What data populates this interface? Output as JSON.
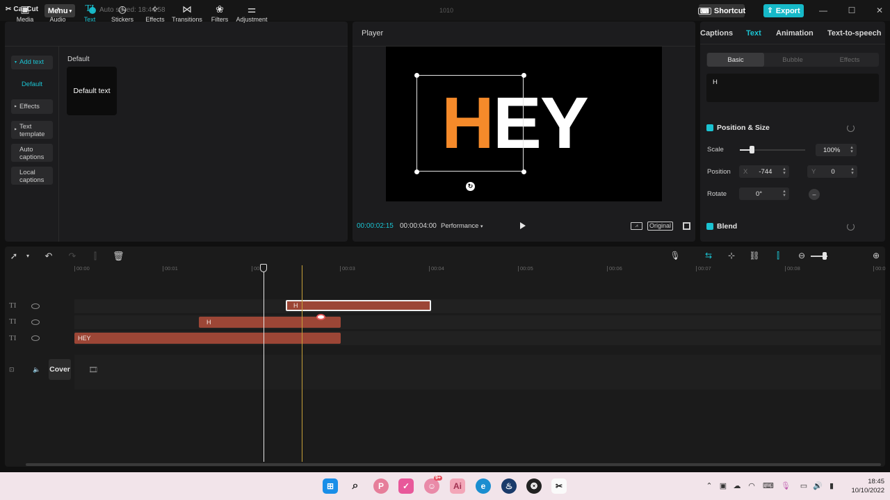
{
  "app": {
    "logo": "CapCut",
    "menu_label": "Menu",
    "autosave": "Auto saved: 18:44:58",
    "project_title": "1010",
    "shortcut_label": "Shortcut",
    "export_label": "Export"
  },
  "toolbar": {
    "items": [
      {
        "label": "Media",
        "icon": "media-icon"
      },
      {
        "label": "Audio",
        "icon": "audio-icon"
      },
      {
        "label": "Text",
        "icon": "text-icon"
      },
      {
        "label": "Stickers",
        "icon": "stickers-icon"
      },
      {
        "label": "Effects",
        "icon": "effects-icon"
      },
      {
        "label": "Transitions",
        "icon": "transitions-icon"
      },
      {
        "label": "Filters",
        "icon": "filters-icon"
      },
      {
        "label": "Adjustment",
        "icon": "adjustment-icon"
      }
    ],
    "active": "Text"
  },
  "sidebar": {
    "items": [
      {
        "label": "Add text"
      },
      {
        "label": "Default"
      },
      {
        "label": "Effects"
      },
      {
        "label": "Text template"
      },
      {
        "label": "Auto captions"
      },
      {
        "label": "Local captions"
      }
    ]
  },
  "library": {
    "section": "Default",
    "card_label": "Default text"
  },
  "player": {
    "title": "Player",
    "preview_text_orange": "H",
    "preview_text_white": "EY",
    "current_time": "00:00:02:15",
    "total_time": "00:00:04:00",
    "performance": "Performance",
    "original_label": "Original"
  },
  "inspector": {
    "tabs": [
      "Captions",
      "Text",
      "Animation",
      "Text-to-speech"
    ],
    "active_tab": "Text",
    "subtabs": [
      "Basic",
      "Bubble",
      "Effects"
    ],
    "active_subtab": "Basic",
    "text_value": "H",
    "position_size": {
      "header": "Position & Size",
      "scale_label": "Scale",
      "scale_value": "100%",
      "position_label": "Position",
      "x_label": "X",
      "x_value": "-744",
      "y_label": "Y",
      "y_value": "0",
      "rotate_label": "Rotate",
      "rotate_value": "0°"
    },
    "blend_header": "Blend"
  },
  "timeline": {
    "ruler": [
      "00:00",
      "00:01",
      "00:02",
      "00:03",
      "00:04",
      "00:05",
      "00:06",
      "00:07",
      "00:08",
      "00:0"
    ],
    "clips": [
      {
        "label": "H",
        "track": 1
      },
      {
        "label": "H",
        "track": 2
      },
      {
        "label": "HEY",
        "track": 3
      }
    ],
    "cover_label": "Cover"
  },
  "taskbar": {
    "time": "18:45",
    "date": "10/10/2022",
    "badge": "9+"
  }
}
